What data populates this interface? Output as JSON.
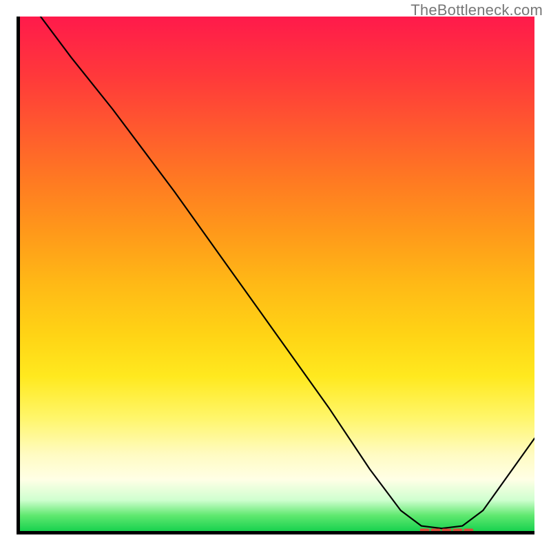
{
  "watermark": "TheBottleneck.com",
  "chart_data": {
    "type": "line",
    "title": "",
    "xlabel": "",
    "ylabel": "",
    "xlim": [
      0,
      100
    ],
    "ylim": [
      0,
      100
    ],
    "grid": false,
    "legend": false,
    "series": [
      {
        "name": "bottleneck-curve",
        "x": [
          4,
          10,
          18,
          24,
          30,
          40,
          50,
          60,
          68,
          74,
          78,
          82,
          86,
          90,
          100
        ],
        "y": [
          100,
          92,
          82,
          74,
          66,
          52,
          38,
          24,
          12,
          4,
          1,
          0.5,
          1,
          4,
          18
        ]
      }
    ],
    "annotations": [
      {
        "name": "optimal-range-marker",
        "type": "dashed-segment",
        "y": 0.2,
        "x_start": 78,
        "x_end": 88,
        "color": "#d84a3a"
      }
    ]
  }
}
